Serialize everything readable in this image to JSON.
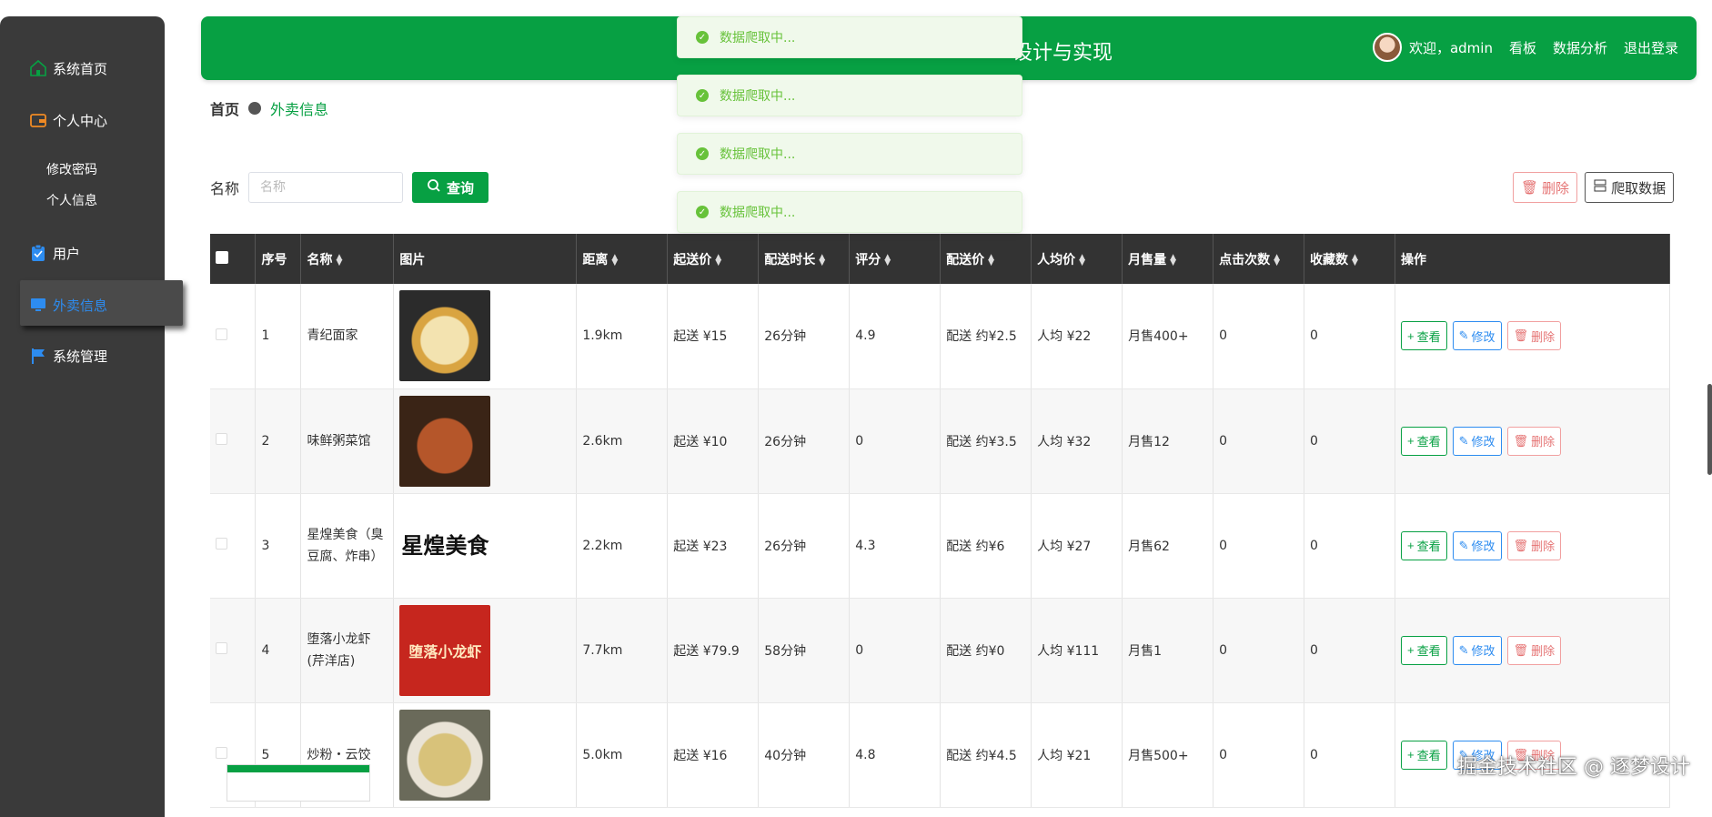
{
  "sidebar": {
    "items": [
      {
        "label": "系统首页",
        "icon": "home-icon"
      },
      {
        "label": "个人中心",
        "icon": "wallet-icon"
      },
      {
        "label": "用户",
        "icon": "clipboard-icon"
      },
      {
        "label": "外卖信息",
        "icon": "monitor-icon"
      },
      {
        "label": "系统管理",
        "icon": "flag-icon"
      }
    ],
    "subitems": [
      "修改密码",
      "个人信息"
    ]
  },
  "header": {
    "title": "设计与实现",
    "welcome": "欢迎，admin",
    "links": [
      "看板",
      "数据分析",
      "退出登录"
    ]
  },
  "breadcrumb": {
    "home": "首页",
    "current": "外卖信息"
  },
  "search": {
    "label": "名称",
    "placeholder": "名称",
    "query_label": "查询"
  },
  "toolbar": {
    "delete_label": "删除",
    "crawl_label": "爬取数据"
  },
  "toasts": [
    "数据爬取中...",
    "数据爬取中...",
    "数据爬取中...",
    "数据爬取中..."
  ],
  "table": {
    "headers": [
      "序号",
      "名称",
      "图片",
      "距离",
      "起送价",
      "配送时长",
      "评分",
      "配送价",
      "人均价",
      "月售量",
      "点击次数",
      "收藏数",
      "操作"
    ],
    "rows": [
      {
        "no": "1",
        "name": "青纪面家",
        "distance": "1.9km",
        "min_price": "起送 ¥15",
        "time": "26分钟",
        "rating": "4.9",
        "delivery": "配送 约¥2.5",
        "avg": "人均 ¥22",
        "sales": "月售400+",
        "clicks": "0",
        "favs": "0"
      },
      {
        "no": "2",
        "name": "味鲜粥菜馆",
        "distance": "2.6km",
        "min_price": "起送 ¥10",
        "time": "26分钟",
        "rating": "0",
        "delivery": "配送 约¥3.5",
        "avg": "人均 ¥32",
        "sales": "月售12",
        "clicks": "0",
        "favs": "0"
      },
      {
        "no": "3",
        "name": "星煌美食（臭豆腐、炸串）",
        "distance": "2.2km",
        "min_price": "起送 ¥23",
        "time": "26分钟",
        "rating": "4.3",
        "delivery": "配送 约¥6",
        "avg": "人均 ¥27",
        "sales": "月售62",
        "clicks": "0",
        "favs": "0"
      },
      {
        "no": "4",
        "name": "堕落小龙虾(芹洋店)",
        "distance": "7.7km",
        "min_price": "起送 ¥79.9",
        "time": "58分钟",
        "rating": "0",
        "delivery": "配送 约¥0",
        "avg": "人均 ¥111",
        "sales": "月售1",
        "clicks": "0",
        "favs": "0"
      },
      {
        "no": "5",
        "name": "炒粉・云饺",
        "distance": "5.0km",
        "min_price": "起送 ¥16",
        "time": "40分钟",
        "rating": "4.8",
        "delivery": "配送 约¥4.5",
        "avg": "人均 ¥21",
        "sales": "月售500+",
        "clicks": "0",
        "favs": "0"
      }
    ],
    "actions": {
      "view": "查看",
      "edit": "修改",
      "delete": "删除"
    },
    "image_text": {
      "row3": "星煌美食",
      "row4": "堕落小龙虾"
    }
  },
  "watermark": "掘金技术社区 @ 逐梦设计",
  "colors": {
    "primary": "#07a043",
    "sidebar": "#3a3a3a",
    "info": "#2d8cf0",
    "danger": "#e57373",
    "toast": "#67c23a"
  }
}
